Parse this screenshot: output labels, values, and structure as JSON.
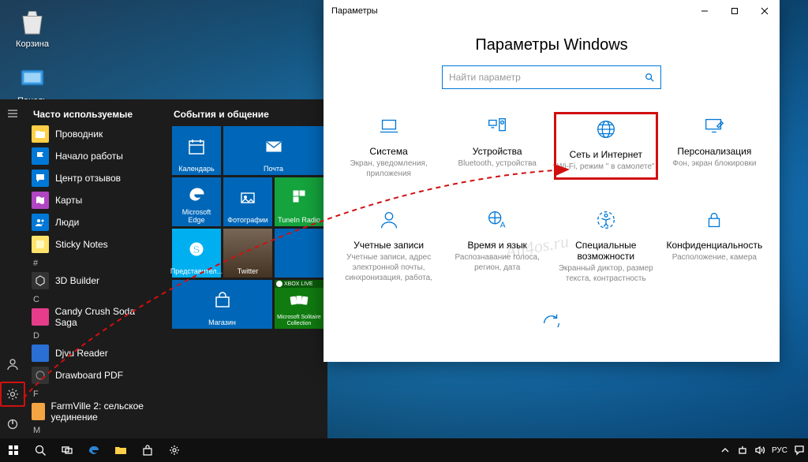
{
  "desktop": {
    "icons": [
      {
        "label": "Корзина"
      },
      {
        "label": "Панель управления"
      }
    ]
  },
  "start_menu": {
    "freq_header": "Часто используемые",
    "freq_apps": [
      {
        "label": "Проводник",
        "color": "#0078d7"
      },
      {
        "label": "Начало работы",
        "color": "#0078d7"
      },
      {
        "label": "Центр отзывов",
        "color": "#0078d7"
      },
      {
        "label": "Карты",
        "color": "#0078d7"
      },
      {
        "label": "Люди",
        "color": "#0078d7"
      },
      {
        "label": "Sticky Notes",
        "color": "#0078d7"
      }
    ],
    "sep1": "#",
    "app_3d": "3D Builder",
    "sep_c": "C",
    "app_candy": "Candy Crush Soda Saga",
    "sep_d": "D",
    "app_djvu": "Djvu Reader",
    "app_draw": "Drawboard PDF",
    "sep_f": "F",
    "app_farm": "FarmVille 2: сельское уединение",
    "sep_m": "M",
    "tiles_header": "События и общение",
    "tiles": [
      {
        "label": "Календарь",
        "color": "#0067b8"
      },
      {
        "label": "Почта",
        "color": "#0067b8"
      },
      {
        "label": "Microsoft Edge",
        "color": "#0067b8"
      },
      {
        "label": "Фотографии",
        "color": "#0067b8"
      },
      {
        "label": "TuneIn Radio",
        "color": "#14a33c"
      },
      {
        "label": "Представител...",
        "color": "#00aff0"
      },
      {
        "label": "Twitter",
        "color": "#333"
      },
      {
        "label": "",
        "color": "#0067b8"
      },
      {
        "label": "Магазин",
        "color": "#0067b8"
      },
      {
        "label": "Microsoft Solitaire Collection",
        "color": "#107c10",
        "badge": "XBOX LIVE"
      }
    ]
  },
  "settings": {
    "window_title": "Параметры",
    "heading": "Параметры Windows",
    "search_placeholder": "Найти параметр",
    "items": [
      {
        "title": "Система",
        "desc": "Экран, уведомления, приложения"
      },
      {
        "title": "Устройства",
        "desc": "Bluetooth, устройства"
      },
      {
        "title": "Сеть и Интернет",
        "desc": "Wi-Fi, режим \" в самолете\"",
        "highlight": true
      },
      {
        "title": "Персонализация",
        "desc": "Фон, экран блокировки"
      },
      {
        "title": "Учетные записи",
        "desc": "Учетные записи, адрес электронной почты, синхронизация, работа,"
      },
      {
        "title": "Время и язык",
        "desc": "Распознавание голоса, регион, дата"
      },
      {
        "title": "Специальные возможности",
        "desc": "Экранный диктор, размер текста, контрастность"
      },
      {
        "title": "Конфиденциальность",
        "desc": "Расположение, камера"
      }
    ]
  },
  "watermark": "All4os.ru"
}
